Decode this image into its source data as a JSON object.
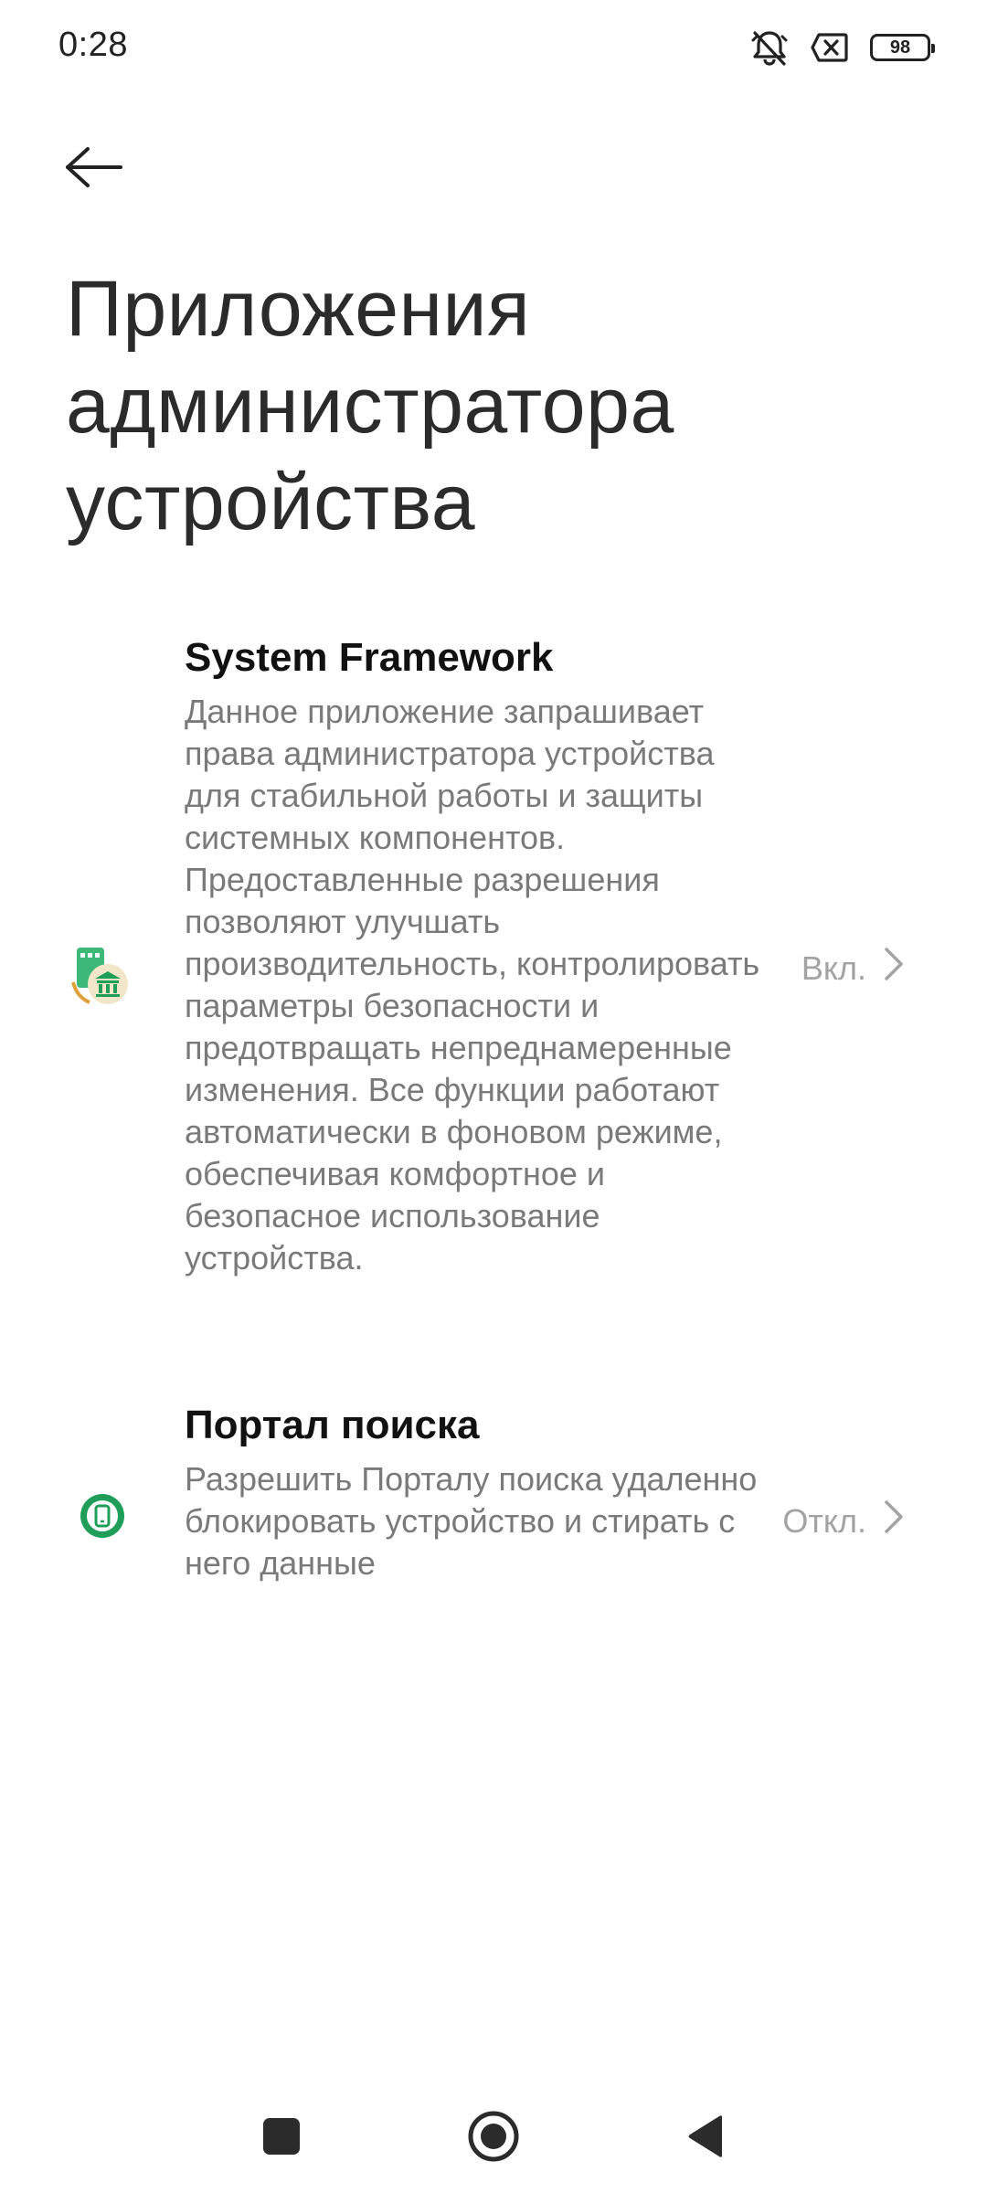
{
  "status_bar": {
    "time": "0:28",
    "battery": "98",
    "icons": [
      "bell-off-icon",
      "sim-x-icon",
      "battery-icon"
    ]
  },
  "header": {
    "back_icon": "arrow-left-icon",
    "title": "Приложения администратора устройства"
  },
  "items": [
    {
      "title": "System Framework",
      "description": "Данное приложение запрашивает права администратора устройства для стабильной работы и защиты системных компонентов. Предоставленные разрешения позволяют улучшать производительность, контролировать параметры безопасности и предотвращать непреднамеренные изменения. Все функции работают автоматически в фоновом режиме, обеспечивая комфортное и безопасное использование устройства.",
      "status": "Вкл.",
      "icon": "bank-app-icon"
    },
    {
      "title": "Портал поиска",
      "description": "Разрешить Порталу поиска удаленно блокировать устройство и стирать с него данные",
      "status": "Откл.",
      "icon": "find-device-icon"
    }
  ],
  "nav_bar": {
    "icons": [
      "recents-square-icon",
      "home-circle-icon",
      "back-triangle-icon"
    ]
  },
  "colors": {
    "title": "#2b2b2b",
    "description": "#7a7a7a",
    "status": "#a3a3a3",
    "icon_green": "#1f9e5a"
  }
}
